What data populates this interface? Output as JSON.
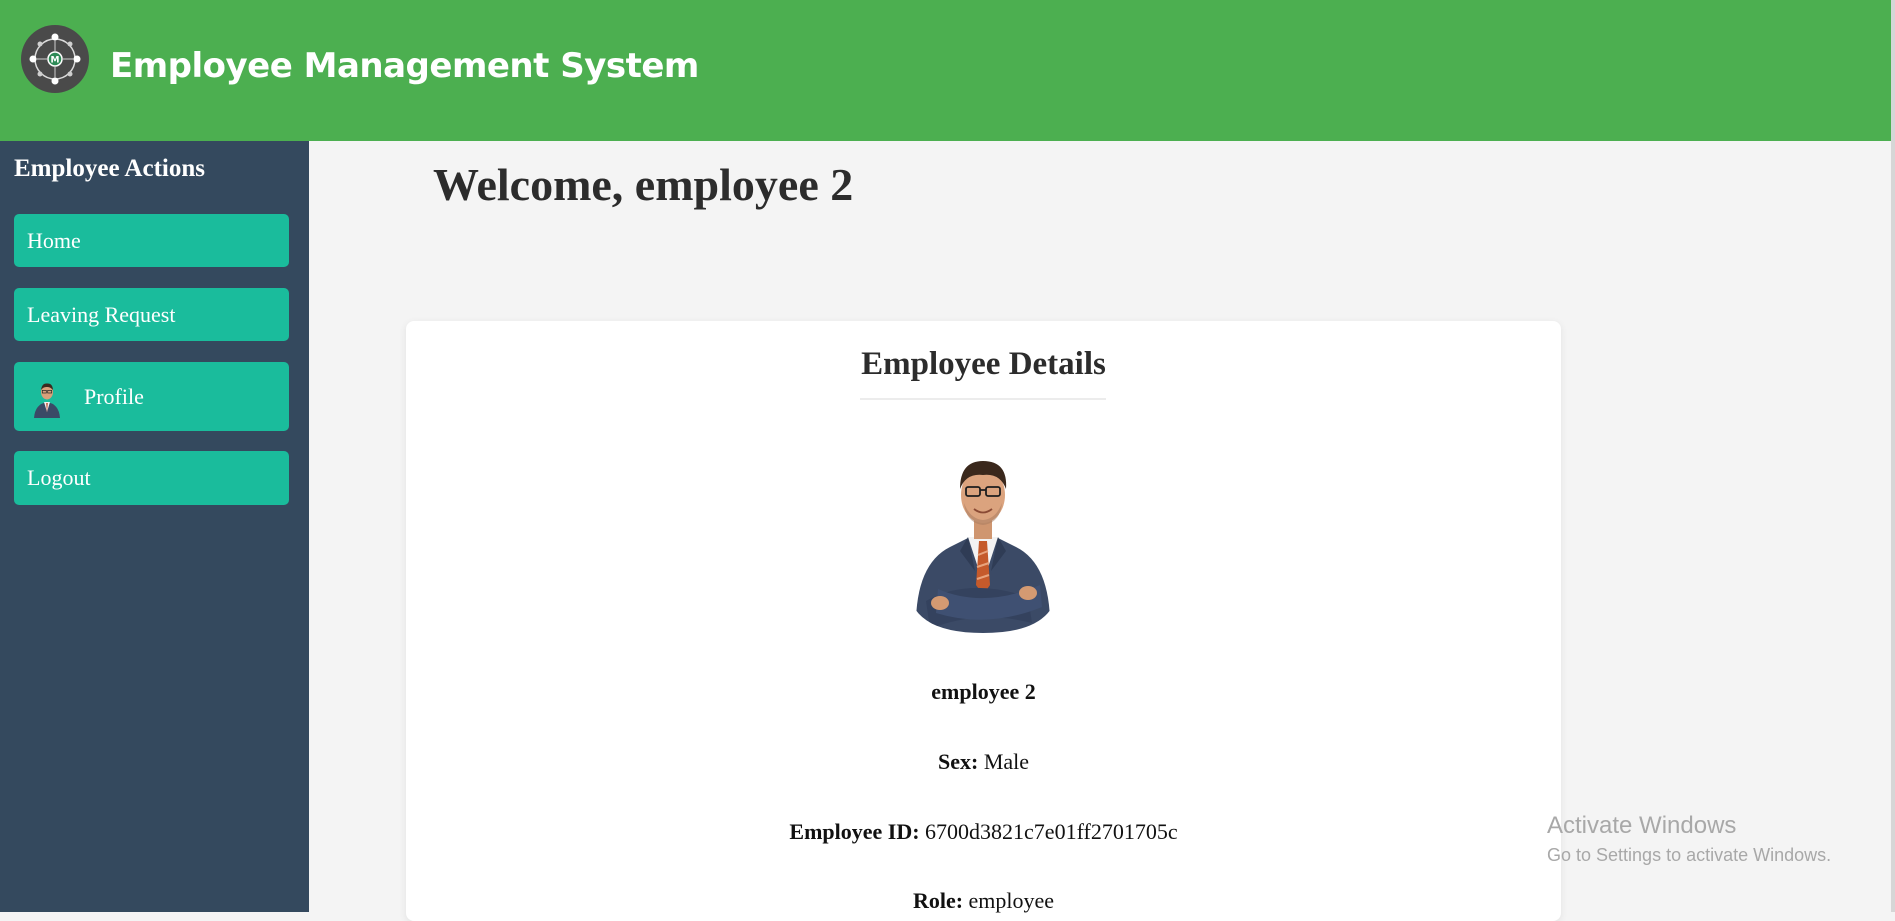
{
  "header": {
    "app_title": "Employee Management System",
    "logo_icon": "system-logo-icon",
    "background_color": "#4caf50"
  },
  "sidebar": {
    "title": "Employee Actions",
    "background_color": "#34495e",
    "button_color": "#1abc9c",
    "items": [
      {
        "label": "Home"
      },
      {
        "label": "Leaving Request"
      },
      {
        "label": "Profile",
        "icon": "profile-avatar-icon"
      },
      {
        "label": "Logout"
      }
    ]
  },
  "main": {
    "welcome": "Welcome, employee 2",
    "card": {
      "title": "Employee Details",
      "name": "employee 2",
      "sex_label": "Sex:",
      "sex_value": "Male",
      "id_label": "Employee ID:",
      "id_value": "6700d3821c7e01ff2701705c",
      "role_label": "Role:",
      "role_value": "employee"
    }
  },
  "watermark": {
    "line1": "Activate Windows",
    "line2": "Go to Settings to activate Windows."
  }
}
